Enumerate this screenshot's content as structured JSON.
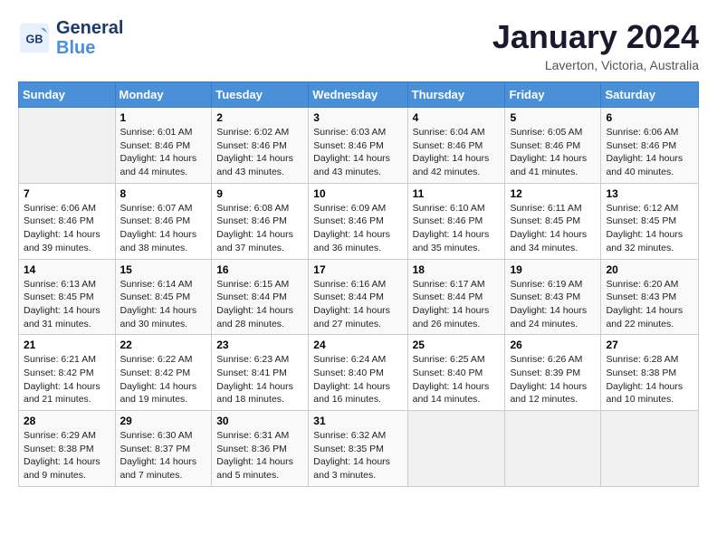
{
  "logo": {
    "line1": "General",
    "line2": "Blue"
  },
  "title": "January 2024",
  "location": "Laverton, Victoria, Australia",
  "weekdays": [
    "Sunday",
    "Monday",
    "Tuesday",
    "Wednesday",
    "Thursday",
    "Friday",
    "Saturday"
  ],
  "weeks": [
    [
      {
        "day": "",
        "sunrise": "",
        "sunset": "",
        "daylight": ""
      },
      {
        "day": "1",
        "sunrise": "Sunrise: 6:01 AM",
        "sunset": "Sunset: 8:46 PM",
        "daylight": "Daylight: 14 hours and 44 minutes."
      },
      {
        "day": "2",
        "sunrise": "Sunrise: 6:02 AM",
        "sunset": "Sunset: 8:46 PM",
        "daylight": "Daylight: 14 hours and 43 minutes."
      },
      {
        "day": "3",
        "sunrise": "Sunrise: 6:03 AM",
        "sunset": "Sunset: 8:46 PM",
        "daylight": "Daylight: 14 hours and 43 minutes."
      },
      {
        "day": "4",
        "sunrise": "Sunrise: 6:04 AM",
        "sunset": "Sunset: 8:46 PM",
        "daylight": "Daylight: 14 hours and 42 minutes."
      },
      {
        "day": "5",
        "sunrise": "Sunrise: 6:05 AM",
        "sunset": "Sunset: 8:46 PM",
        "daylight": "Daylight: 14 hours and 41 minutes."
      },
      {
        "day": "6",
        "sunrise": "Sunrise: 6:06 AM",
        "sunset": "Sunset: 8:46 PM",
        "daylight": "Daylight: 14 hours and 40 minutes."
      }
    ],
    [
      {
        "day": "7",
        "sunrise": "Sunrise: 6:06 AM",
        "sunset": "Sunset: 8:46 PM",
        "daylight": "Daylight: 14 hours and 39 minutes."
      },
      {
        "day": "8",
        "sunrise": "Sunrise: 6:07 AM",
        "sunset": "Sunset: 8:46 PM",
        "daylight": "Daylight: 14 hours and 38 minutes."
      },
      {
        "day": "9",
        "sunrise": "Sunrise: 6:08 AM",
        "sunset": "Sunset: 8:46 PM",
        "daylight": "Daylight: 14 hours and 37 minutes."
      },
      {
        "day": "10",
        "sunrise": "Sunrise: 6:09 AM",
        "sunset": "Sunset: 8:46 PM",
        "daylight": "Daylight: 14 hours and 36 minutes."
      },
      {
        "day": "11",
        "sunrise": "Sunrise: 6:10 AM",
        "sunset": "Sunset: 8:46 PM",
        "daylight": "Daylight: 14 hours and 35 minutes."
      },
      {
        "day": "12",
        "sunrise": "Sunrise: 6:11 AM",
        "sunset": "Sunset: 8:45 PM",
        "daylight": "Daylight: 14 hours and 34 minutes."
      },
      {
        "day": "13",
        "sunrise": "Sunrise: 6:12 AM",
        "sunset": "Sunset: 8:45 PM",
        "daylight": "Daylight: 14 hours and 32 minutes."
      }
    ],
    [
      {
        "day": "14",
        "sunrise": "Sunrise: 6:13 AM",
        "sunset": "Sunset: 8:45 PM",
        "daylight": "Daylight: 14 hours and 31 minutes."
      },
      {
        "day": "15",
        "sunrise": "Sunrise: 6:14 AM",
        "sunset": "Sunset: 8:45 PM",
        "daylight": "Daylight: 14 hours and 30 minutes."
      },
      {
        "day": "16",
        "sunrise": "Sunrise: 6:15 AM",
        "sunset": "Sunset: 8:44 PM",
        "daylight": "Daylight: 14 hours and 28 minutes."
      },
      {
        "day": "17",
        "sunrise": "Sunrise: 6:16 AM",
        "sunset": "Sunset: 8:44 PM",
        "daylight": "Daylight: 14 hours and 27 minutes."
      },
      {
        "day": "18",
        "sunrise": "Sunrise: 6:17 AM",
        "sunset": "Sunset: 8:44 PM",
        "daylight": "Daylight: 14 hours and 26 minutes."
      },
      {
        "day": "19",
        "sunrise": "Sunrise: 6:19 AM",
        "sunset": "Sunset: 8:43 PM",
        "daylight": "Daylight: 14 hours and 24 minutes."
      },
      {
        "day": "20",
        "sunrise": "Sunrise: 6:20 AM",
        "sunset": "Sunset: 8:43 PM",
        "daylight": "Daylight: 14 hours and 22 minutes."
      }
    ],
    [
      {
        "day": "21",
        "sunrise": "Sunrise: 6:21 AM",
        "sunset": "Sunset: 8:42 PM",
        "daylight": "Daylight: 14 hours and 21 minutes."
      },
      {
        "day": "22",
        "sunrise": "Sunrise: 6:22 AM",
        "sunset": "Sunset: 8:42 PM",
        "daylight": "Daylight: 14 hours and 19 minutes."
      },
      {
        "day": "23",
        "sunrise": "Sunrise: 6:23 AM",
        "sunset": "Sunset: 8:41 PM",
        "daylight": "Daylight: 14 hours and 18 minutes."
      },
      {
        "day": "24",
        "sunrise": "Sunrise: 6:24 AM",
        "sunset": "Sunset: 8:40 PM",
        "daylight": "Daylight: 14 hours and 16 minutes."
      },
      {
        "day": "25",
        "sunrise": "Sunrise: 6:25 AM",
        "sunset": "Sunset: 8:40 PM",
        "daylight": "Daylight: 14 hours and 14 minutes."
      },
      {
        "day": "26",
        "sunrise": "Sunrise: 6:26 AM",
        "sunset": "Sunset: 8:39 PM",
        "daylight": "Daylight: 14 hours and 12 minutes."
      },
      {
        "day": "27",
        "sunrise": "Sunrise: 6:28 AM",
        "sunset": "Sunset: 8:38 PM",
        "daylight": "Daylight: 14 hours and 10 minutes."
      }
    ],
    [
      {
        "day": "28",
        "sunrise": "Sunrise: 6:29 AM",
        "sunset": "Sunset: 8:38 PM",
        "daylight": "Daylight: 14 hours and 9 minutes."
      },
      {
        "day": "29",
        "sunrise": "Sunrise: 6:30 AM",
        "sunset": "Sunset: 8:37 PM",
        "daylight": "Daylight: 14 hours and 7 minutes."
      },
      {
        "day": "30",
        "sunrise": "Sunrise: 6:31 AM",
        "sunset": "Sunset: 8:36 PM",
        "daylight": "Daylight: 14 hours and 5 minutes."
      },
      {
        "day": "31",
        "sunrise": "Sunrise: 6:32 AM",
        "sunset": "Sunset: 8:35 PM",
        "daylight": "Daylight: 14 hours and 3 minutes."
      },
      {
        "day": "",
        "sunrise": "",
        "sunset": "",
        "daylight": ""
      },
      {
        "day": "",
        "sunrise": "",
        "sunset": "",
        "daylight": ""
      },
      {
        "day": "",
        "sunrise": "",
        "sunset": "",
        "daylight": ""
      }
    ]
  ]
}
